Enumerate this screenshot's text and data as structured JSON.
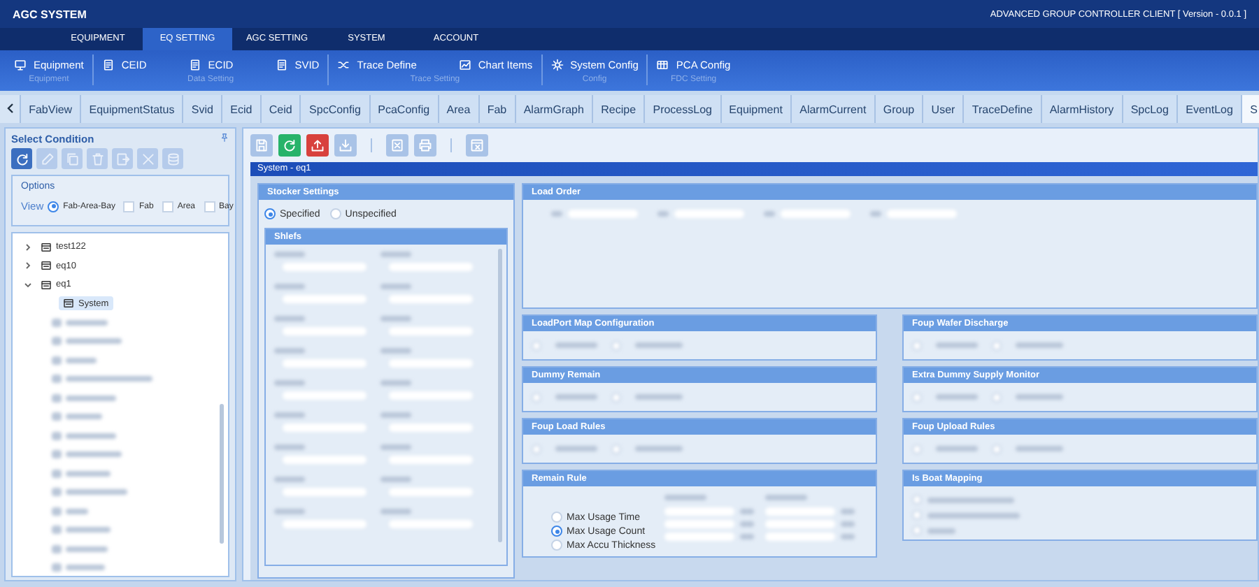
{
  "app": {
    "title": "AGC SYSTEM",
    "client_title": "ADVANCED GROUP CONTROLLER CLIENT [ Version - 0.0.1 ]"
  },
  "menu": [
    {
      "label": "EQUIPMENT",
      "selected": false
    },
    {
      "label": "EQ SETTING",
      "selected": true
    },
    {
      "label": "AGC SETTING",
      "selected": false
    },
    {
      "label": "SYSTEM",
      "selected": false
    },
    {
      "label": "ACCOUNT",
      "selected": false
    }
  ],
  "ribbon": [
    {
      "group": "Equipment",
      "items": [
        {
          "label": "Equipment"
        }
      ]
    },
    {
      "group": "Data Setting",
      "items": [
        {
          "label": "CEID"
        },
        {
          "label": "ECID"
        },
        {
          "label": "SVID"
        }
      ]
    },
    {
      "group": "Trace Setting",
      "items": [
        {
          "label": "Trace Define"
        },
        {
          "label": "Chart Items"
        }
      ]
    },
    {
      "group": "Config",
      "items": [
        {
          "label": "System Config"
        }
      ]
    },
    {
      "group": "FDC Setting",
      "items": [
        {
          "label": "PCA Config"
        }
      ]
    }
  ],
  "tabs": [
    {
      "label": "FabView",
      "selected": false
    },
    {
      "label": "EquipmentStatus",
      "selected": false
    },
    {
      "label": "Svid",
      "selected": false
    },
    {
      "label": "Ecid",
      "selected": false
    },
    {
      "label": "Ceid",
      "selected": false
    },
    {
      "label": "SpcConfig",
      "selected": false
    },
    {
      "label": "PcaConfig",
      "selected": false
    },
    {
      "label": "Area",
      "selected": false
    },
    {
      "label": "Fab",
      "selected": false
    },
    {
      "label": "AlarmGraph",
      "selected": false
    },
    {
      "label": "Recipe",
      "selected": false
    },
    {
      "label": "ProcessLog",
      "selected": false
    },
    {
      "label": "Equipment",
      "selected": false
    },
    {
      "label": "AlarmCurrent",
      "selected": false
    },
    {
      "label": "Group",
      "selected": false
    },
    {
      "label": "User",
      "selected": false
    },
    {
      "label": "TraceDefine",
      "selected": false
    },
    {
      "label": "AlarmHistory",
      "selected": false
    },
    {
      "label": "SpcLog",
      "selected": false
    },
    {
      "label": "EventLog",
      "selected": false
    },
    {
      "label": "S",
      "selected": true
    }
  ],
  "left_panel": {
    "title": "Select Condition",
    "tools": [
      {
        "selected": true
      },
      {
        "selected": false
      },
      {
        "selected": false
      },
      {
        "selected": false
      },
      {
        "selected": false
      },
      {
        "selected": false
      },
      {
        "selected": false
      }
    ],
    "options": {
      "title": "Options",
      "view_label": "View",
      "choices": [
        {
          "label": "Fab-Area-Bay",
          "kind": "radio",
          "checked": true
        },
        {
          "label": "Fab",
          "kind": "checkbox",
          "checked": false
        },
        {
          "label": "Area",
          "kind": "checkbox",
          "checked": false
        },
        {
          "label": "Bay",
          "kind": "checkbox",
          "checked": false
        }
      ]
    },
    "tree": [
      {
        "label": "test122",
        "expanded": false,
        "selected": false
      },
      {
        "label": "eq10",
        "expanded": false,
        "selected": false
      },
      {
        "label": "eq1",
        "expanded": true,
        "selected": false,
        "children": [
          {
            "label": "System",
            "selected": true
          }
        ]
      }
    ]
  },
  "toolbar": [
    {
      "kind": "button",
      "color": "#a9c3e7"
    },
    {
      "kind": "button",
      "color": "#27b36a"
    },
    {
      "kind": "button",
      "color": "#d8413d"
    },
    {
      "kind": "button",
      "color": "#a9c3e7"
    },
    {
      "kind": "separator"
    },
    {
      "kind": "button",
      "color": "#a9c3e7"
    },
    {
      "kind": "button",
      "color": "#a9c3e7"
    },
    {
      "kind": "separator"
    },
    {
      "kind": "button",
      "color": "#a9c3e7"
    }
  ],
  "content": {
    "title": "System - eq1",
    "stocker": {
      "title": "Stocker Settings",
      "options": [
        {
          "label": "Specified",
          "selected": true
        },
        {
          "label": "Unspecified",
          "selected": false
        }
      ],
      "shelves_title": "Shlefs"
    },
    "load_order": {
      "title": "Load Order"
    },
    "panels": [
      {
        "title": "LoadPort Map Configuration",
        "kind": "options"
      },
      {
        "title": "Foup Wafer Discharge",
        "kind": "options"
      },
      {
        "title": "Dummy Remain",
        "kind": "options"
      },
      {
        "title": "Extra Dummy Supply Monitor",
        "kind": "options"
      },
      {
        "title": "Foup Load Rules",
        "kind": "options"
      },
      {
        "title": "Foup Upload Rules",
        "kind": "options"
      },
      {
        "title": "Remain Rule",
        "kind": "remain_rule",
        "options": [
          {
            "label": "Max Usage Time",
            "selected": false
          },
          {
            "label": "Max Usage Count",
            "selected": true
          },
          {
            "label": "Max Accu Thickness",
            "selected": false
          }
        ]
      },
      {
        "title": "Is Boat Mapping",
        "kind": "mapping"
      }
    ]
  }
}
